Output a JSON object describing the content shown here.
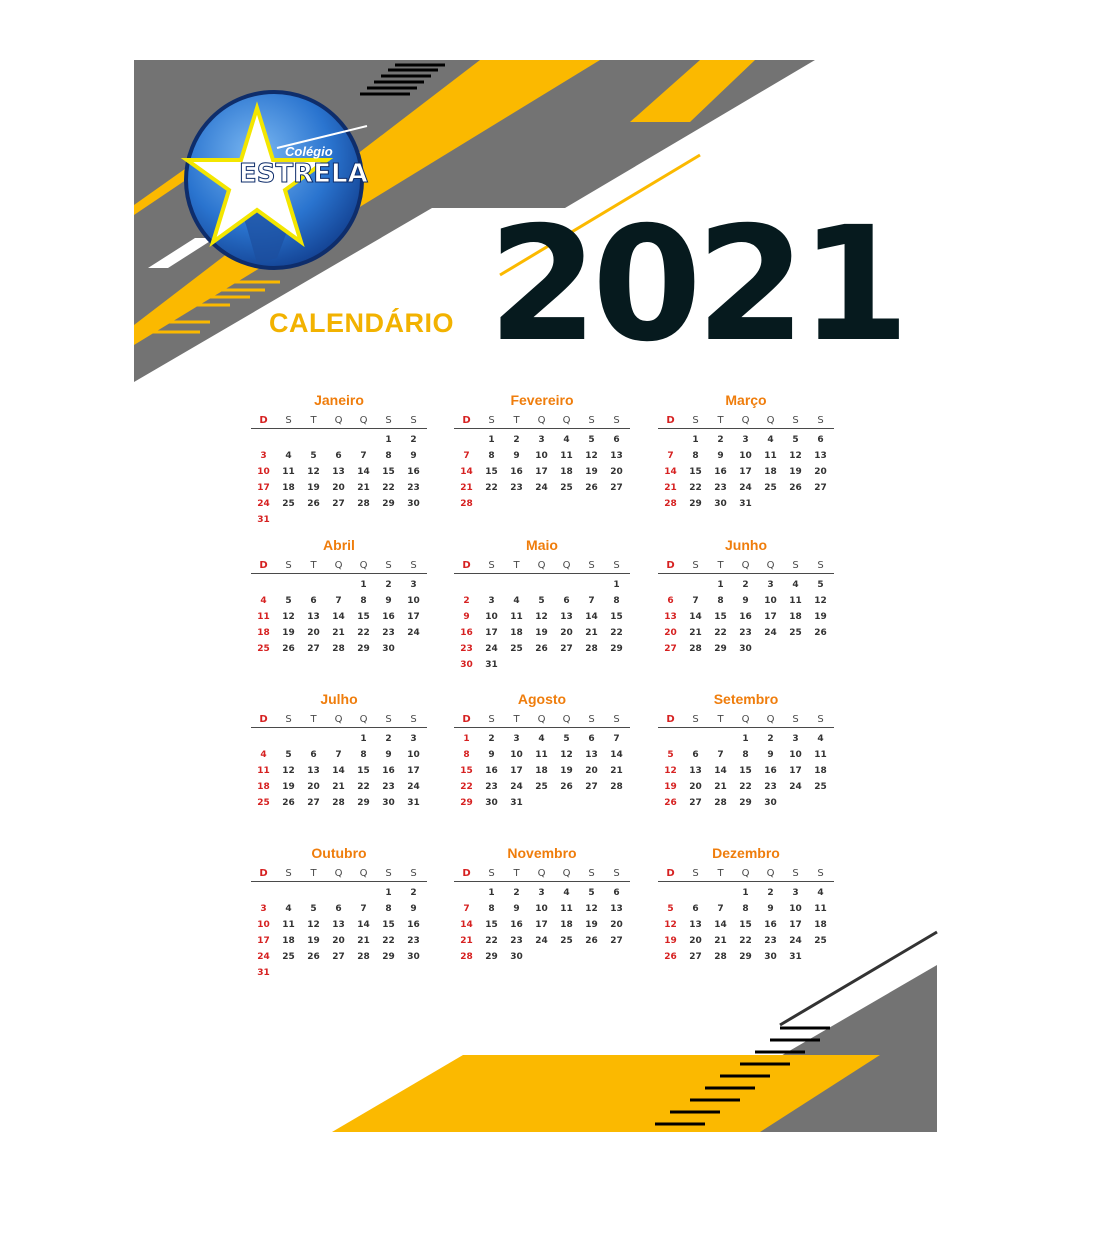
{
  "header": {
    "title": "CALENDÁRIO",
    "year": "2021"
  },
  "logo": {
    "top_text": "Colégio",
    "main_text": "ESTRELA"
  },
  "weekday_labels": [
    "D",
    "S",
    "T",
    "Q",
    "Q",
    "S",
    "S"
  ],
  "colors": {
    "accent_yellow": "#fbb900",
    "gray": "#737373",
    "dark": "#061a1e",
    "month_orange": "#ef7d0c",
    "sunday_red": "#d62121"
  },
  "months": [
    {
      "name": "Janeiro",
      "start": 5,
      "days": 31
    },
    {
      "name": "Fevereiro",
      "start": 1,
      "days": 28
    },
    {
      "name": "Março",
      "start": 1,
      "days": 31
    },
    {
      "name": "Abril",
      "start": 4,
      "days": 30
    },
    {
      "name": "Maio",
      "start": 6,
      "days": 31
    },
    {
      "name": "Junho",
      "start": 2,
      "days": 30
    },
    {
      "name": "Julho",
      "start": 4,
      "days": 31
    },
    {
      "name": "Agosto",
      "start": 0,
      "days": 31
    },
    {
      "name": "Setembro",
      "start": 3,
      "days": 30
    },
    {
      "name": "Outubro",
      "start": 5,
      "days": 31
    },
    {
      "name": "Novembro",
      "start": 1,
      "days": 30
    },
    {
      "name": "Dezembro",
      "start": 3,
      "days": 31
    }
  ]
}
